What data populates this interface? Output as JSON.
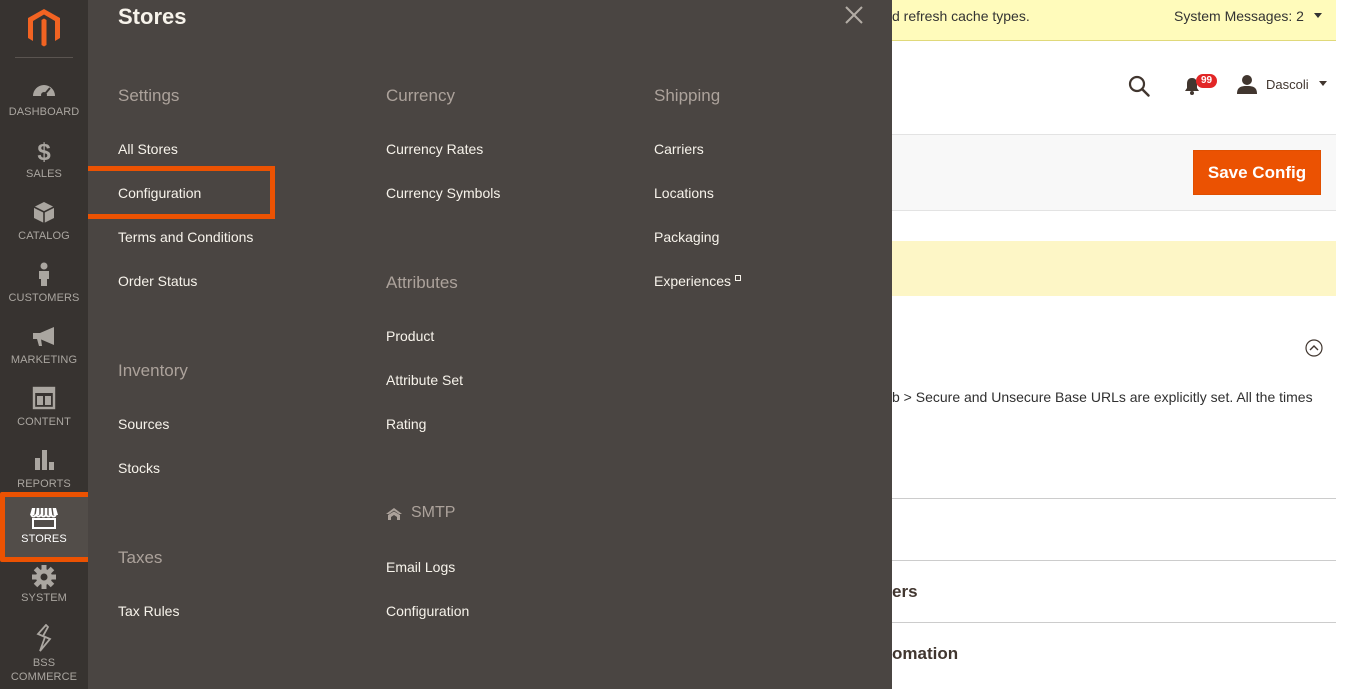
{
  "nav": {
    "items": [
      {
        "label": "DASHBOARD",
        "icon": "dashboard-icon"
      },
      {
        "label": "SALES",
        "icon": "dollar-icon"
      },
      {
        "label": "CATALOG",
        "icon": "cube-icon"
      },
      {
        "label": "CUSTOMERS",
        "icon": "person-icon"
      },
      {
        "label": "MARKETING",
        "icon": "megaphone-icon"
      },
      {
        "label": "CONTENT",
        "icon": "layout-icon"
      },
      {
        "label": "REPORTS",
        "icon": "bar-chart-icon"
      },
      {
        "label": "STORES",
        "icon": "storefront-icon"
      },
      {
        "label": "SYSTEM",
        "icon": "gear-icon"
      },
      {
        "label_line1": "BSS",
        "label_line2": "COMMERCE",
        "icon": "bss-logo-icon"
      }
    ]
  },
  "flyout": {
    "title": "Stores",
    "settings": {
      "heading": "Settings",
      "links": [
        "All Stores",
        "Configuration",
        "Terms and Conditions",
        "Order Status"
      ]
    },
    "inventory": {
      "heading": "Inventory",
      "links": [
        "Sources",
        "Stocks"
      ]
    },
    "taxes": {
      "heading": "Taxes",
      "links": [
        "Tax Rules"
      ]
    },
    "currency": {
      "heading": "Currency",
      "links": [
        "Currency Rates",
        "Currency Symbols"
      ]
    },
    "attributes": {
      "heading": "Attributes",
      "links": [
        "Product",
        "Attribute Set",
        "Rating"
      ]
    },
    "smtp": {
      "heading": "SMTP",
      "links": [
        "Email Logs",
        "Configuration"
      ]
    },
    "shipping": {
      "heading": "Shipping",
      "links": [
        "Carriers",
        "Locations",
        "Packaging",
        "Experiences"
      ]
    }
  },
  "system_bar": {
    "message": "d refresh cache types.",
    "messages_label": "System Messages: 2"
  },
  "header": {
    "notification_count": "99",
    "user_name": "Dascoli"
  },
  "actions": {
    "save_label": "Save Config"
  },
  "content": {
    "text": "b > Secure and Unsecure Base URLs are explicitly set. All the times",
    "section1": "ers",
    "section2": "omation"
  },
  "colors": {
    "accent": "#eb5202",
    "nav_bg": "#373330",
    "flyout_bg": "#4a4542"
  }
}
